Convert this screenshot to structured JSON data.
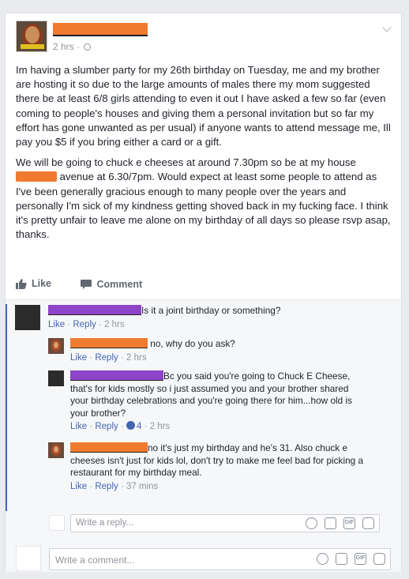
{
  "post": {
    "time": "2 hrs",
    "paragraph1": "Im having a slumber party for my 26th birthday on Tuesday, me and my brother are hosting it so due to the large amounts of males there my mom suggested there be at least 6/8 girls attending to even it out I have asked a few so far (even coming to people's houses and giving them a personal invitation but so far my effort has gone unwanted as per usual) if anyone wants to attend message me, Ill pay you $5 if you bring either a card or a gift.",
    "paragraph2_a": "We will be going to chuck e cheeses at around 7.30pm so be at my house ",
    "paragraph2_b": " avenue at 6.30/7pm. Would expect at least some people to attend as I've been generally gracious enough to many people over the years and personally I'm sick of my kindness getting shoved back in my fucking face. I think it's pretty unfair to leave me alone on my birthday of all days so please rsvp asap, thanks."
  },
  "actions": {
    "like": "Like",
    "comment": "Comment"
  },
  "comments": [
    {
      "text": "Is it a joint birthday or something?",
      "like": "Like",
      "reply": "Reply",
      "time": "2 hrs"
    },
    {
      "text": "no, why do you ask?",
      "like": "Like",
      "reply": "Reply",
      "time": "2 hrs"
    },
    {
      "text": "Bc you said you're going to Chuck E Cheese, that's for kids mostly so i just assumed you and your brother shared your birthday celebrations and you're going there for him...how old is your brother?",
      "like": "Like",
      "reply": "Reply",
      "reactions": "4",
      "time": "2 hrs"
    },
    {
      "text": "no it's just my birthday and he's 31. Also chuck e cheeses isn't just for kids lol, don't try to make me feel bad for picking a restaurant for my birthday meal.",
      "like": "Like",
      "reply": "Reply",
      "time": "37 mins"
    }
  ],
  "reply_placeholder": "Write a reply...",
  "comment_placeholder": "Write a comment...",
  "gif_label": "GIF",
  "colors": {
    "link": "#4267b2",
    "redact_orange": "#f07b2e",
    "redact_purple": "#8e44c9"
  }
}
